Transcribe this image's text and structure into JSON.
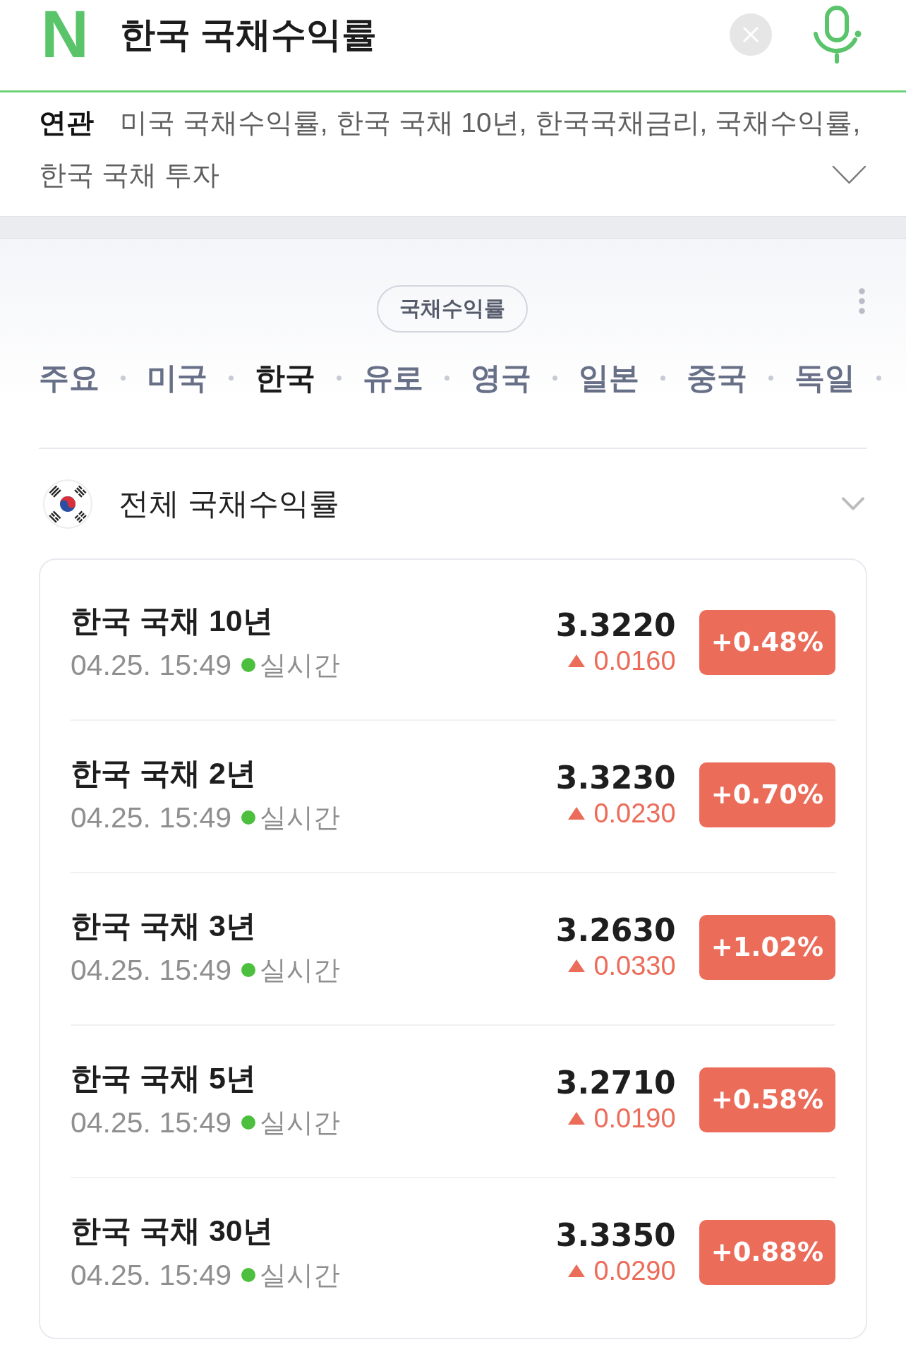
{
  "search": {
    "logo": "N",
    "query": "한국 국채수익률"
  },
  "related": {
    "label": "연관",
    "items": [
      "미국 국채수익률,",
      "한국 국채 10년,",
      "한국국채금리,",
      "국채수익률,",
      "한국 국채 투자"
    ],
    "expanded": false
  },
  "category_chip": "국채수익률",
  "tabs": [
    {
      "label": "주요",
      "selected": false
    },
    {
      "label": "미국",
      "selected": false
    },
    {
      "label": "한국",
      "selected": true
    },
    {
      "label": "유로",
      "selected": false
    },
    {
      "label": "영국",
      "selected": false
    },
    {
      "label": "일본",
      "selected": false
    },
    {
      "label": "중국",
      "selected": false
    },
    {
      "label": "독일",
      "selected": false
    }
  ],
  "summary": {
    "title": "전체 국채수익률",
    "expanded": false
  },
  "rows": [
    {
      "name": "한국 국채 10년",
      "time": "04.25. 15:49",
      "live": true,
      "live_label": "실시간",
      "value": "3.3220",
      "rising": true,
      "change": "0.0160",
      "percent": "+0.48%"
    },
    {
      "name": "한국 국채 2년",
      "time": "04.25. 15:49",
      "live": true,
      "live_label": "실시간",
      "value": "3.3230",
      "rising": true,
      "change": "0.0230",
      "percent": "+0.70%"
    },
    {
      "name": "한국 국채 3년",
      "time": "04.25. 15:49",
      "live": true,
      "live_label": "실시간",
      "value": "3.2630",
      "rising": true,
      "change": "0.0330",
      "percent": "+1.02%"
    },
    {
      "name": "한국 국채 5년",
      "time": "04.25. 15:49",
      "live": true,
      "live_label": "실시간",
      "value": "3.2710",
      "rising": true,
      "change": "0.0190",
      "percent": "+0.58%"
    },
    {
      "name": "한국 국채 30년",
      "time": "04.25. 15:49",
      "live": true,
      "live_label": "실시간",
      "value": "3.3350",
      "rising": true,
      "change": "0.0290",
      "percent": "+0.88%"
    }
  ]
}
